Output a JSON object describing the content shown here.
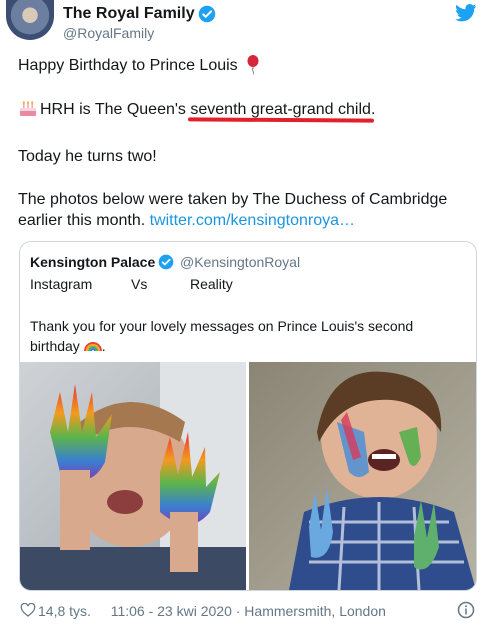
{
  "header": {
    "name": "The Royal Family",
    "handle": "@RoyalFamily"
  },
  "tweet": {
    "line1": "Happy Birthday to Prince Louis",
    "line2_prefix": "HRH is The Queen's ",
    "line2_highlight": "seventh great-grand child",
    "line2_suffix": ".",
    "line3": "Today he turns two!",
    "line4": "The photos below were taken by The Duchess of Cambridge",
    "line5_text": "earlier this month. ",
    "line5_link": "twitter.com/kensingtonroya…"
  },
  "quote": {
    "name": "Kensington Palace",
    "handle": "@KensingtonRoyal",
    "col1": "Instagram",
    "col2": "Vs",
    "col3": "Reality",
    "text_line1": "Thank you for your lovely messages on Prince Louis's second",
    "text_line2": "birthday"
  },
  "footer": {
    "likes": "14,8 tys.",
    "meta": "11:06 - 23 kwi 2020 · Hammersmith, London"
  },
  "colors": {
    "link": "#1b95e0",
    "verified": "#1da1f2",
    "underline": "#e0202a",
    "muted": "#657786"
  }
}
